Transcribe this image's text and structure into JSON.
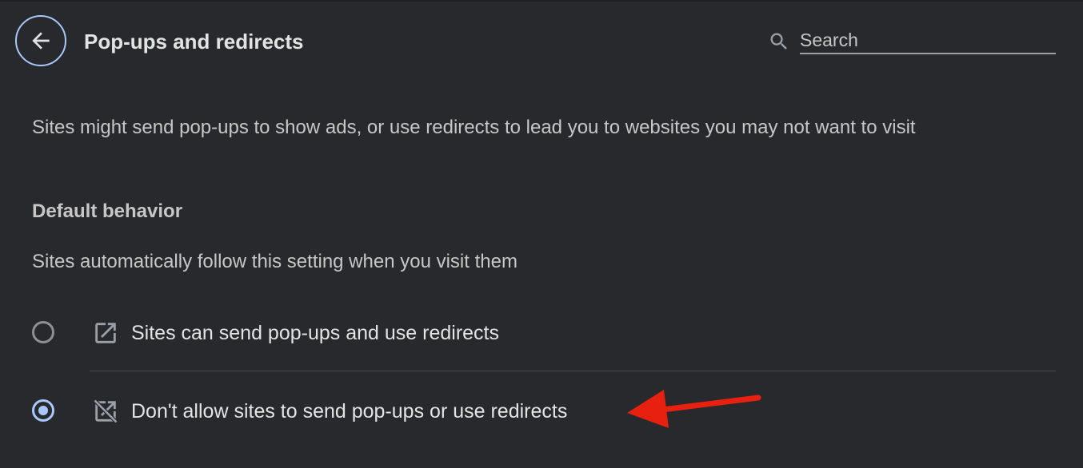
{
  "header": {
    "title": "Pop-ups and redirects",
    "back_icon": "arrow-back-icon"
  },
  "search": {
    "placeholder": "Search",
    "icon": "search-icon"
  },
  "description": "Sites might send pop-ups to show ads, or use redirects to lead you to websites you may not want to visit",
  "default_behavior": {
    "heading": "Default behavior",
    "subtext": "Sites automatically follow this setting when you visit them",
    "options": [
      {
        "label": "Sites can send pop-ups and use redirects",
        "icon": "open-in-new-icon",
        "selected": false
      },
      {
        "label": "Don't allow sites to send pop-ups or use redirects",
        "icon": "open-in-new-off-icon",
        "selected": true
      }
    ]
  },
  "colors": {
    "background": "#28292c",
    "accent": "#a8c7fa",
    "annotation_arrow": "#e8200f"
  }
}
